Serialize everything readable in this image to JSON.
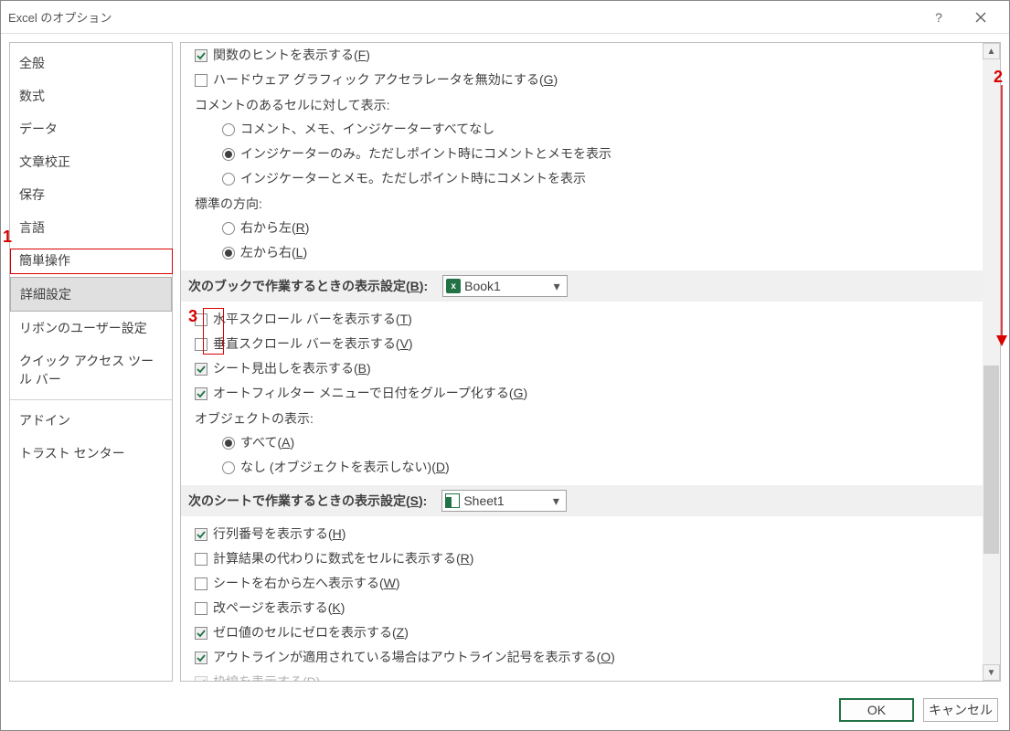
{
  "window": {
    "title": "Excel のオプション"
  },
  "sidebar": {
    "items": [
      "全般",
      "数式",
      "データ",
      "文章校正",
      "保存",
      "言語",
      "簡単操作",
      "詳細設定",
      "リボンのユーザー設定",
      "クイック アクセス ツール バー",
      "アドイン",
      "トラスト センター"
    ],
    "selected_index": 7
  },
  "section_top": {
    "show_function_hints": {
      "label_pre": "関数のヒントを表示する(",
      "key": "F",
      "label_post": ")",
      "checked": true
    },
    "disable_hw_accel": {
      "label_pre": "ハードウェア グラフィック アクセラレータを無効にする(",
      "key": "G",
      "label_post": ")",
      "checked": false
    },
    "comment_heading": "コメントのあるセルに対して表示:",
    "comment_opts": [
      {
        "label": "コメント、メモ、インジケーターすべてなし",
        "checked": false
      },
      {
        "label": "インジケーターのみ。ただしポイント時にコメントとメモを表示",
        "checked": true
      },
      {
        "label": "インジケーターとメモ。ただしポイント時にコメントを表示",
        "checked": false
      }
    ],
    "direction_heading": "標準の方向:",
    "direction_opts": [
      {
        "label_pre": "右から左(",
        "key": "R",
        "label_post": ")",
        "checked": false
      },
      {
        "label_pre": "左から右(",
        "key": "L",
        "label_post": ")",
        "checked": true
      }
    ]
  },
  "section_book": {
    "title_pre": "次のブックで作業するときの表示設定(",
    "title_key": "B",
    "title_post": "):",
    "combo_value": "Book1",
    "opts": {
      "hscroll": {
        "label_pre": "水平スクロール バーを表示する(",
        "key": "T",
        "label_post": ")",
        "checked": false
      },
      "vscroll": {
        "label_pre": "垂直スクロール バーを表示する(",
        "key": "V",
        "label_post": ")",
        "checked": false
      },
      "tabs": {
        "label_pre": "シート見出しを表示する(",
        "key": "B",
        "label_post": ")",
        "checked": true
      },
      "autofilter_group_dates": {
        "label_pre": "オートフィルター メニューで日付をグループ化する(",
        "key": "G",
        "label_post": ")",
        "checked": true
      }
    },
    "objects_heading": "オブジェクトの表示:",
    "object_opts": [
      {
        "label_pre": "すべて(",
        "key": "A",
        "label_post": ")",
        "checked": true
      },
      {
        "label_pre": "なし (オブジェクトを表示しない)(",
        "key": "D",
        "label_post": ")",
        "checked": false
      }
    ]
  },
  "section_sheet": {
    "title_pre": "次のシートで作業するときの表示設定(",
    "title_key": "S",
    "title_post": "):",
    "combo_value": "Sheet1",
    "opts": [
      {
        "label_pre": "行列番号を表示する(",
        "key": "H",
        "label_post": ")",
        "checked": true
      },
      {
        "label_pre": "計算結果の代わりに数式をセルに表示する(",
        "key": "R",
        "label_post": ")",
        "checked": false
      },
      {
        "label_pre": "シートを右から左へ表示する(",
        "key": "W",
        "label_post": ")",
        "checked": false
      },
      {
        "label_pre": "改ページを表示する(",
        "key": "K",
        "label_post": ")",
        "checked": false
      },
      {
        "label_pre": "ゼロ値のセルにゼロを表示する(",
        "key": "Z",
        "label_post": ")",
        "checked": true
      },
      {
        "label_pre": "アウトラインが適用されている場合はアウトライン記号を表示する(",
        "key": "O",
        "label_post": ")",
        "checked": true
      },
      {
        "label_pre": "枠線を表示する(",
        "key": "D",
        "label_post": ")",
        "checked": true
      }
    ]
  },
  "footer": {
    "ok": "OK",
    "cancel": "キャンセル"
  },
  "annotations": {
    "n1": "1",
    "n2": "2",
    "n3": "3"
  }
}
